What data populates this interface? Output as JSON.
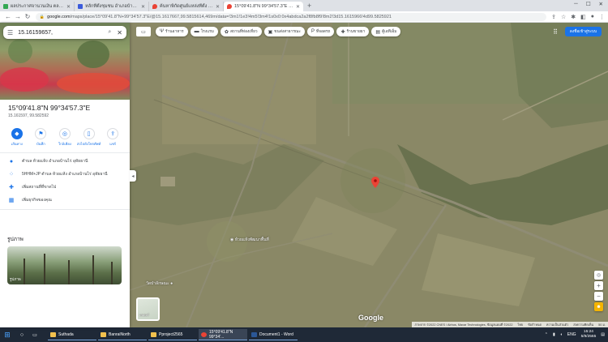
{
  "browser": {
    "tabs": [
      {
        "title": "ผลประกาศจานวนเงิน ตลอดลิ ลาง การเงิน...",
        "favicon_color": "#34a853",
        "active": false
      },
      {
        "title": "หลักที่ตั้งชุมชน อำเภอบ้านไร่",
        "favicon_color": "#3b5bdb",
        "active": false
      },
      {
        "title": "ค้นหาพิกัดศูนย์แหล่งที่ตั้ง (Landuse Map)",
        "favicon_color": "#ea4335",
        "active": false
      },
      {
        "title": "15°09'41.8\"N 99°34'57.3\"E - Google Maps",
        "favicon_color": "#ea4335",
        "active": true
      }
    ],
    "new_tab": "+",
    "window_controls": [
      "─",
      "☐",
      "✕"
    ],
    "url_host": "google.com",
    "url_path": "/maps/place/15°09'41.8\"N+99°34'57.3\"E/@15.1617667,99.5815614,469m/data=!3m1!1e3!4m5!3m4!1s0x0:0x4abdca2a2f8fb8f9!8m2!3d15.1615966!4d99.5825921"
  },
  "panel": {
    "search_value": "15.16159657,",
    "coords_title": "15°09'41.8\"N 99°34'57.3\"E",
    "coords_sub": "15.161597, 99.582592",
    "actions": [
      {
        "label": "เส้นทาง",
        "icon": "directions-icon",
        "glyph": "◆"
      },
      {
        "label": "บันทึก",
        "icon": "bookmark-icon",
        "glyph": "⚑"
      },
      {
        "label": "ใกล้เคียง",
        "icon": "nearby-icon",
        "glyph": "◎"
      },
      {
        "label": "ส่งไปยังโทรศัพท์",
        "icon": "phone-icon",
        "glyph": "▯"
      },
      {
        "label": "แชร์",
        "icon": "share-icon",
        "glyph": "⇪"
      }
    ],
    "info_rows": [
      {
        "icon": "place-icon",
        "glyph": "●",
        "text": "ตำบล ห้วยแห้ง อำเภอบ้านไร่ อุทัยธานี"
      },
      {
        "icon": "plus-code-icon",
        "glyph": "⁘",
        "text": "5HHM+JP ตำบล ห้วยแห้ง อำเภอบ้านไร่ อุทัยธานี"
      },
      {
        "icon": "add-place-icon",
        "glyph": "✚",
        "text": "เพิ่มสถานที่ที่ขาดไป"
      },
      {
        "icon": "business-icon",
        "glyph": "▦",
        "text": "เพิ่มธุรกิจของคุณ"
      }
    ],
    "photos_heading": "รูปภาพ",
    "photo_caption": "รูปภาพ"
  },
  "map": {
    "layers_label": "▭",
    "chips": [
      {
        "icon": "restaurant-icon",
        "glyph": "Ψ",
        "label": "ร้านอาหาร"
      },
      {
        "icon": "hotel-icon",
        "glyph": "▬",
        "label": "โรงแรม"
      },
      {
        "icon": "attraction-icon",
        "glyph": "✿",
        "label": "สถานที่ท่องเที่ยว"
      },
      {
        "icon": "transit-icon",
        "glyph": "▣",
        "label": "ขนส่งสาธารณะ"
      },
      {
        "icon": "parking-icon",
        "glyph": "P",
        "label": "ที่จอดรถ"
      },
      {
        "icon": "pharmacy-icon",
        "glyph": "✚",
        "label": "ร้านขายยา"
      },
      {
        "icon": "atm-icon",
        "glyph": "▤",
        "label": "ตู้เอทีเอ็ม"
      }
    ],
    "signin_label": "ลงชื่อเข้าสู่ระบบ",
    "poi1": "ห้วยแห้งพัฒนาพื้นที่",
    "poi2": "วัดป่าลักษณะ",
    "layers_thumb_label": "เลเยอร์",
    "logo": "Google",
    "attribution": [
      "ภาพจาก ©2022 CNES / Airbus, Maxar Technologies, ข้อมูลแผนที่ ©2022",
      "ไทย",
      "ข้อกำหนด",
      "ความเป็นส่วนตัว",
      "ส่งความคิดเห็น",
      "50 ม."
    ],
    "zoom_in": "+",
    "zoom_out": "−",
    "pin_color": "#ea4335"
  },
  "taskbar": {
    "items": [
      {
        "label": "Suthada",
        "color": "#f3c14e",
        "active": false
      },
      {
        "label": "BanraiNorth",
        "color": "#f3c14e",
        "active": false
      },
      {
        "label": "Pproject2565",
        "color": "#f3c14e",
        "active": false
      },
      {
        "label": "15°09'41.8\"N 99°34'...",
        "color": "#ea4335",
        "active": true
      },
      {
        "label": "Document1 - Word",
        "color": "#2b5797",
        "active": false
      }
    ],
    "lang": "ENG",
    "time": "15:24",
    "date": "5/9/2565"
  }
}
